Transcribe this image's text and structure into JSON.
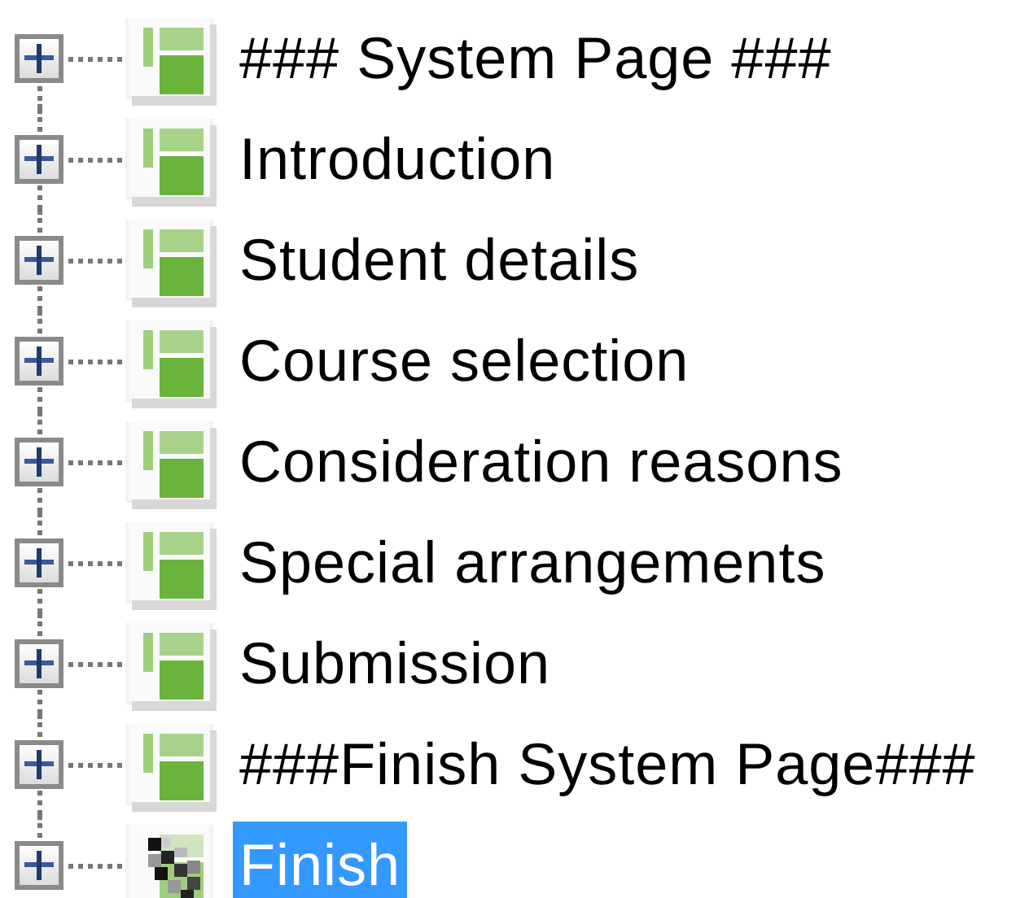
{
  "tree": {
    "items": [
      {
        "label": "### System Page ###",
        "kind": "page",
        "expanded": false,
        "selected": false
      },
      {
        "label": "Introduction",
        "kind": "page",
        "expanded": false,
        "selected": false
      },
      {
        "label": "Student details",
        "kind": "page",
        "expanded": false,
        "selected": false
      },
      {
        "label": "Course selection",
        "kind": "page",
        "expanded": false,
        "selected": false
      },
      {
        "label": "Consideration reasons",
        "kind": "page",
        "expanded": false,
        "selected": false
      },
      {
        "label": "Special arrangements",
        "kind": "page",
        "expanded": false,
        "selected": false
      },
      {
        "label": "Submission",
        "kind": "page",
        "expanded": false,
        "selected": false
      },
      {
        "label": "###Finish System Page###",
        "kind": "page",
        "expanded": false,
        "selected": false
      },
      {
        "label": "Finish",
        "kind": "finish",
        "expanded": false,
        "selected": true
      }
    ]
  }
}
